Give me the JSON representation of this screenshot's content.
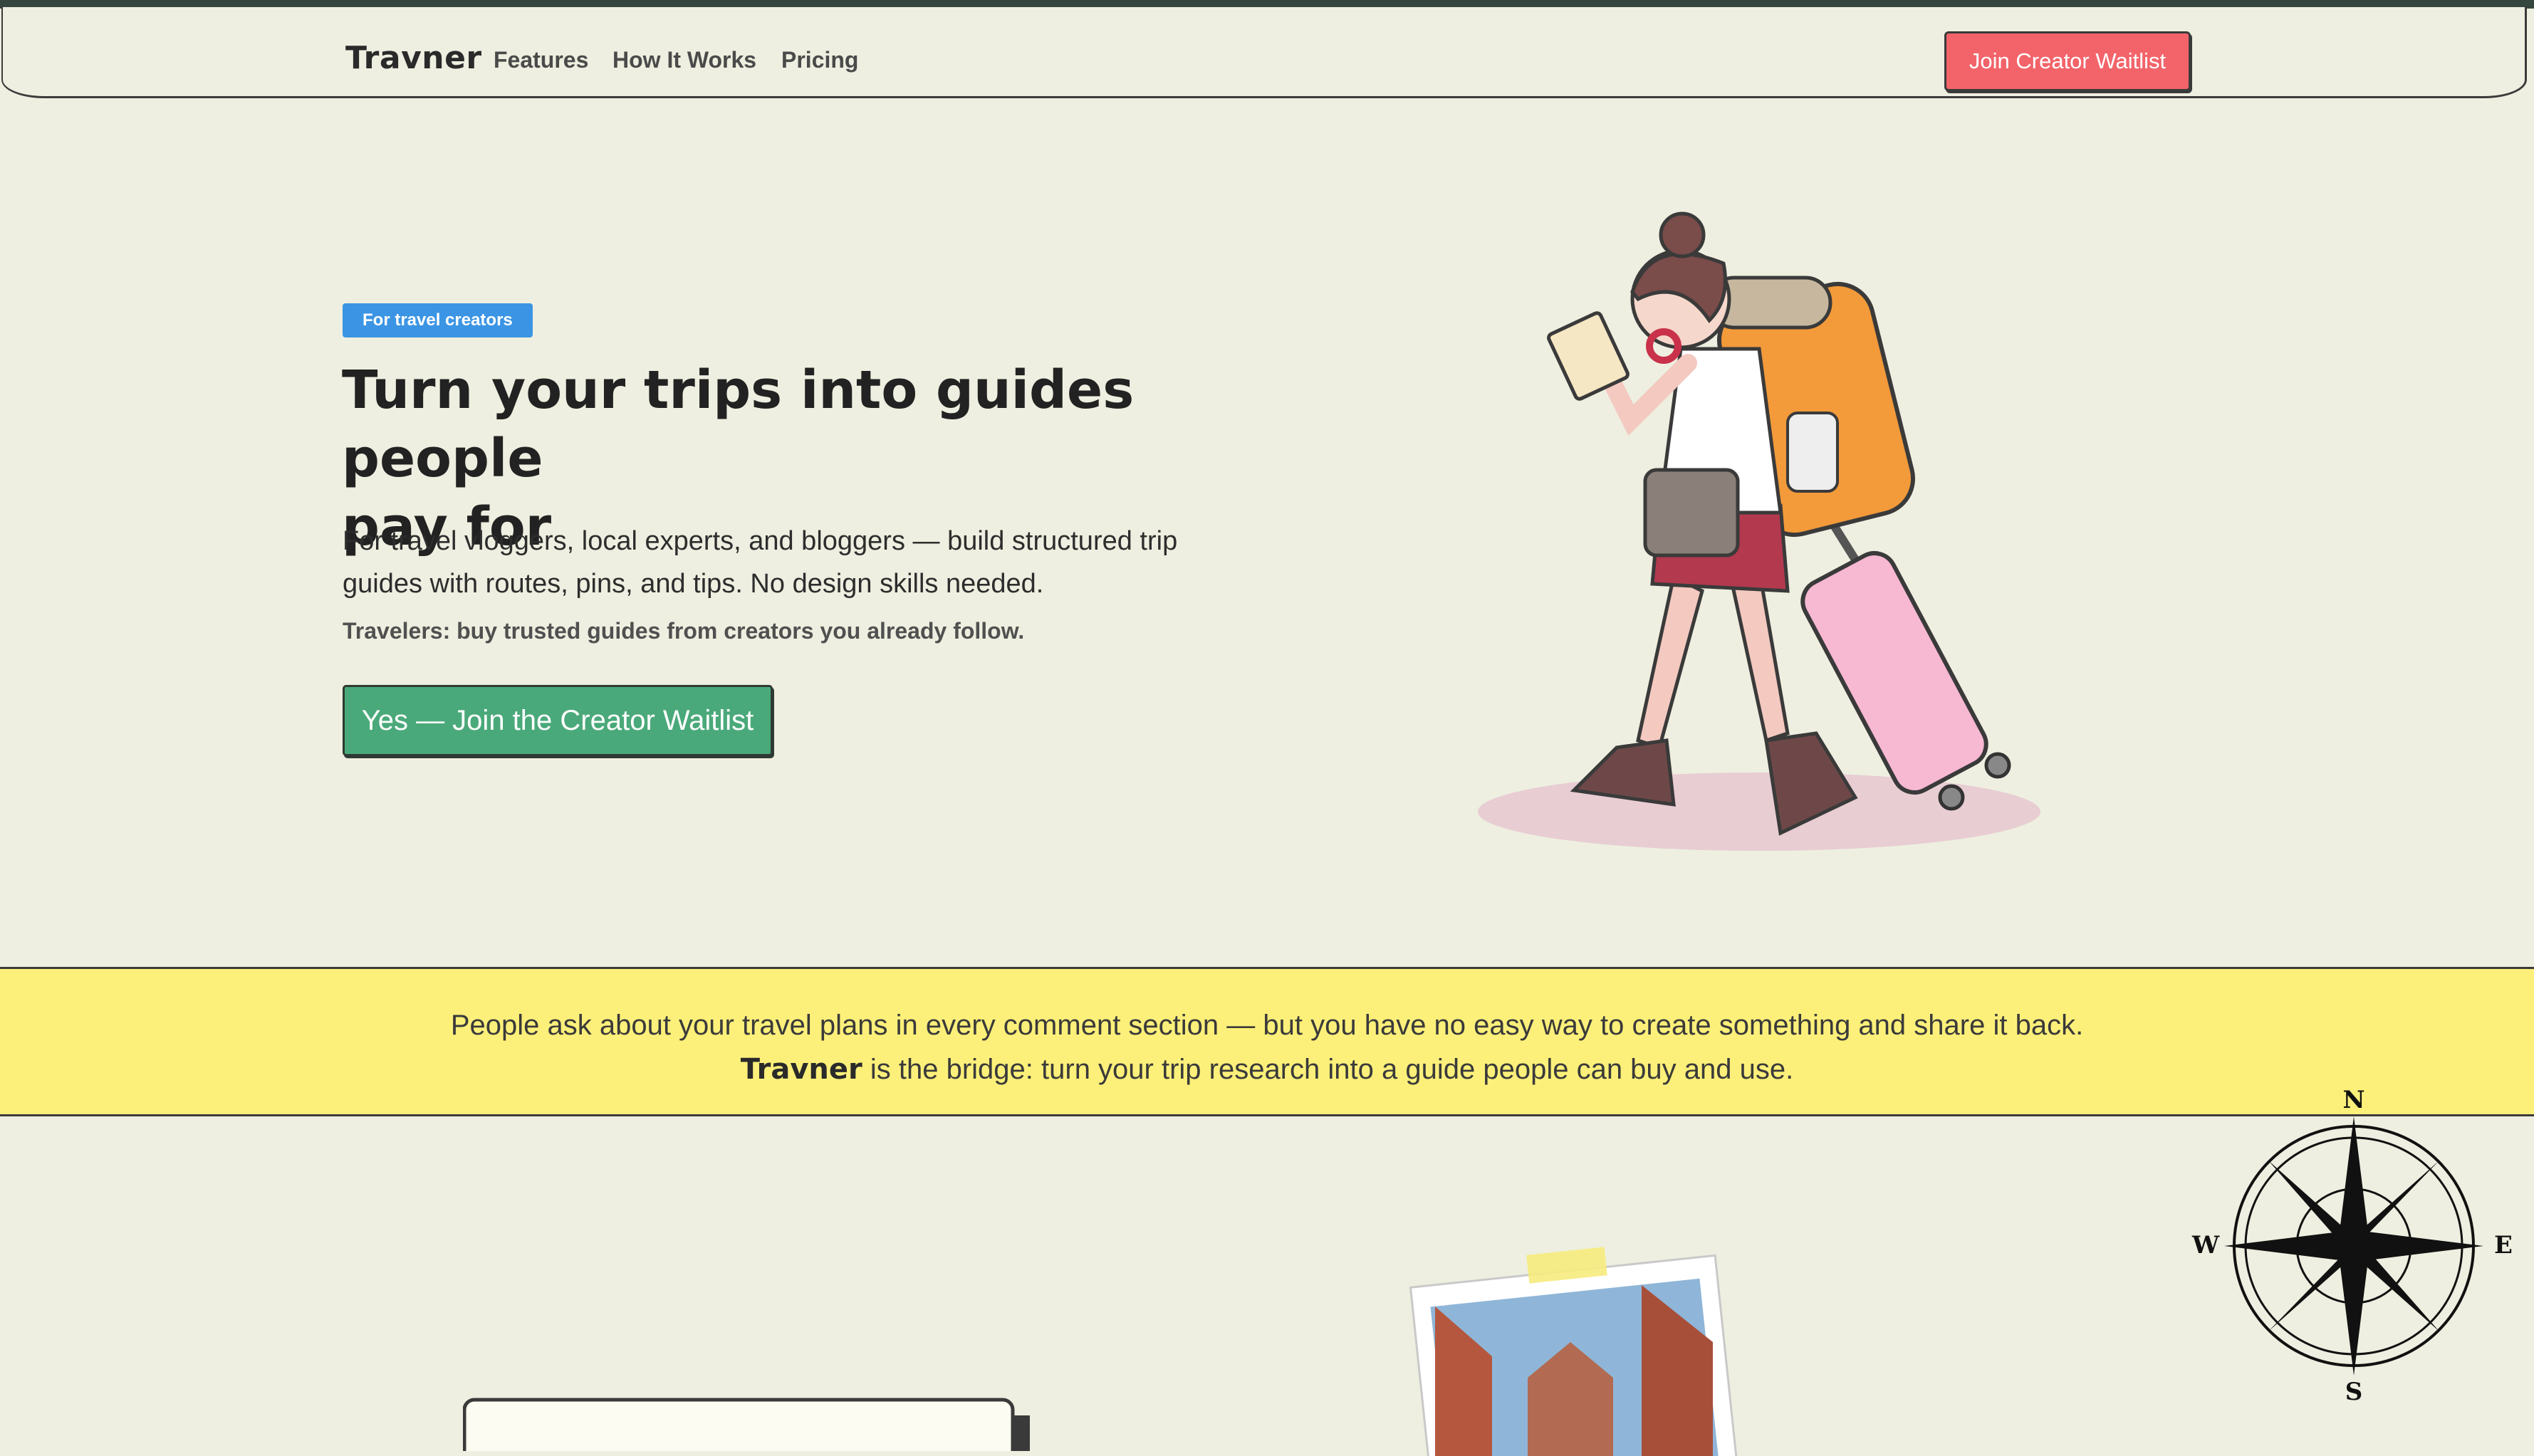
{
  "nav": {
    "brand": "Travner",
    "links": [
      "Features",
      "How It Works",
      "Pricing"
    ],
    "cta": "Join Creator Waitlist"
  },
  "hero": {
    "badge": "For travel creators",
    "headline_line1": "Turn your trips into guides people",
    "headline_line2": "pay for",
    "sub_line1": "For travel vloggers, local experts, and bloggers — build structured trip",
    "sub_line2": "guides with routes, pins, and tips. No design skills needed.",
    "note": "Travelers: buy trusted guides from creators you already follow.",
    "cta": "Yes — Join the Creator Waitlist"
  },
  "banner": {
    "line1": "People ask about your travel plans in every comment section — but you have no easy way to create something and share it back.",
    "brand": "Travner",
    "line2_rest": " is the bridge: turn your trip research into a guide people can buy and use."
  },
  "compass": {
    "n": "N",
    "e": "E",
    "s": "S",
    "w": "W"
  },
  "colors": {
    "background": "#eeefe0",
    "accent_red": "#f2646a",
    "accent_green": "#4aa97a",
    "badge_blue": "#3b95e4",
    "banner_yellow": "#fdf07a"
  }
}
